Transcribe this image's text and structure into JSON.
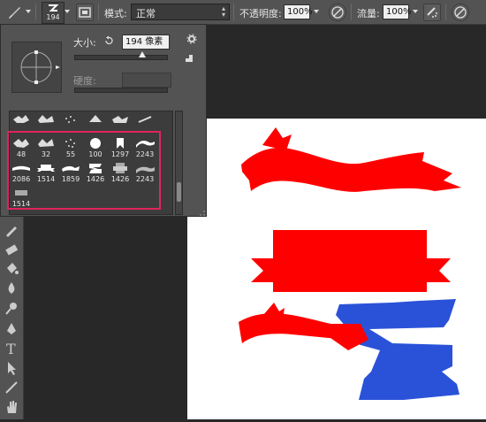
{
  "options_bar": {
    "brush_size_value": "194",
    "mode_label": "模式:",
    "mode_value": "正常",
    "opacity_label": "不透明度:",
    "opacity_value": "100%",
    "flow_label": "流量:",
    "flow_value": "100%"
  },
  "brush_panel": {
    "size_label": "大小:",
    "size_value": "194 像素",
    "hardness_label": "硬度:",
    "preset_rows": [
      [
        "",
        "",
        "",
        "",
        "",
        ""
      ],
      [
        "48",
        "32",
        "55",
        "100",
        "1297",
        "2243"
      ],
      [
        "2086",
        "1514",
        "1859",
        "1426",
        "1426",
        "2243"
      ],
      [
        "1514"
      ]
    ]
  },
  "colors": {
    "ui_bg": "#535353",
    "dark_bg": "#282828",
    "highlight": "#e0245e",
    "ribbon_red": "#ff0000",
    "ribbon_blue": "#2a52d8"
  }
}
